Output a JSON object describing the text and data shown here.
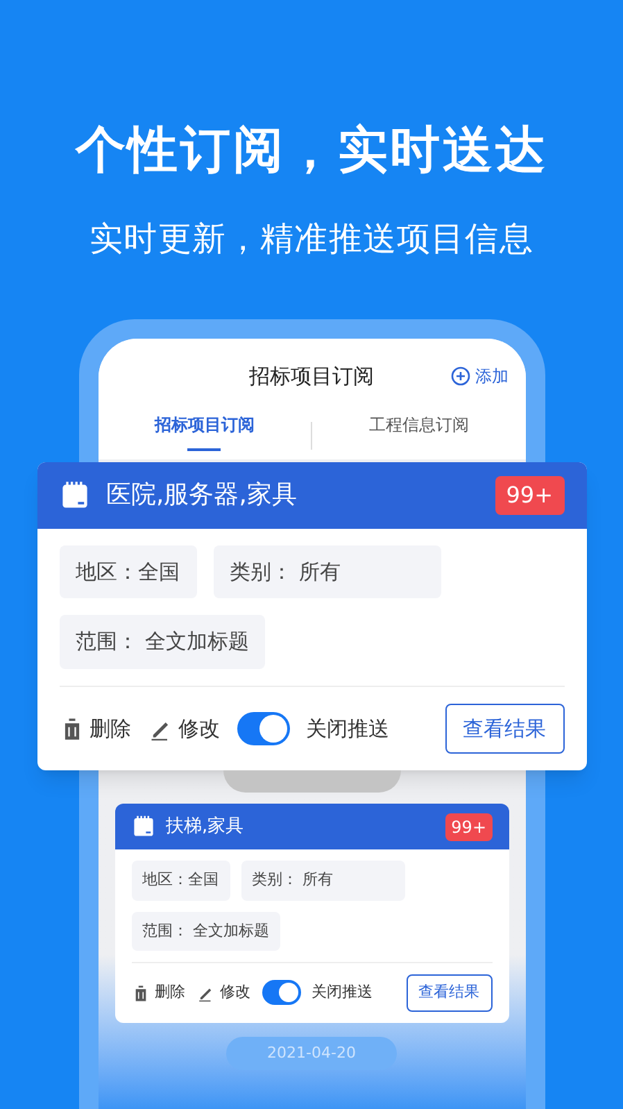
{
  "headline": "个性订阅，实时送达",
  "subheadline": "实时更新，精准推送项目信息",
  "screen": {
    "title": "招标项目订阅",
    "add_button": "添加",
    "tabs": [
      {
        "label": "招标项目订阅",
        "selected": true
      },
      {
        "label": "工程信息订阅",
        "selected": false
      }
    ]
  },
  "subscriptions": [
    {
      "kind": "featured",
      "title": "医院,服务器,家具",
      "badge": "99+",
      "tags": [
        "地区：全国",
        "类别： 所有",
        "范围： 全文加标题"
      ],
      "delete": "删除",
      "edit": "修改",
      "push_on": true,
      "push_label": "关闭推送",
      "view": "查看结果"
    },
    {
      "kind": "normal",
      "title": "扶梯,家具",
      "badge": "99+",
      "tags": [
        "地区：全国",
        "类别： 所有",
        "范围： 全文加标题"
      ],
      "delete": "删除",
      "edit": "修改",
      "push_on": true,
      "push_label": "关闭推送",
      "view": "查看结果"
    }
  ],
  "date": "2021-04-20"
}
